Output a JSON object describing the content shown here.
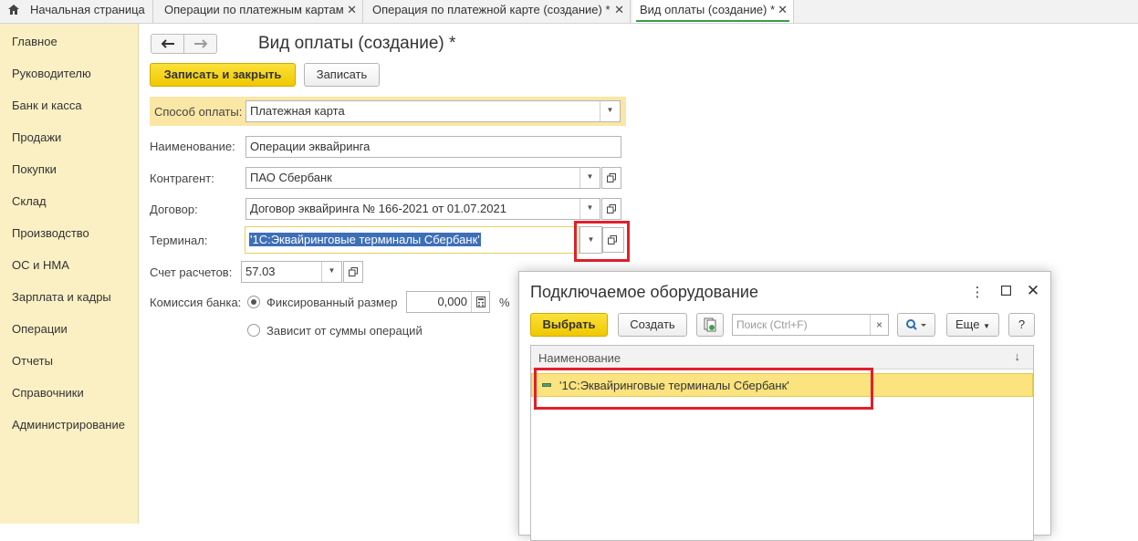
{
  "tabs": [
    {
      "label": "Начальная страница"
    },
    {
      "label": "Операции по платежным картам",
      "close": "✕"
    },
    {
      "label": "Операция по платежной карте (создание) *",
      "close": "✕"
    },
    {
      "label": "Вид оплаты (создание) *",
      "close": "✕"
    }
  ],
  "sidebar": {
    "items": [
      {
        "label": "Главное"
      },
      {
        "label": "Руководителю"
      },
      {
        "label": "Банк и касса"
      },
      {
        "label": "Продажи"
      },
      {
        "label": "Покупки"
      },
      {
        "label": "Склад"
      },
      {
        "label": "Производство"
      },
      {
        "label": "ОС и НМА"
      },
      {
        "label": "Зарплата и кадры"
      },
      {
        "label": "Операции"
      },
      {
        "label": "Отчеты"
      },
      {
        "label": "Справочники"
      },
      {
        "label": "Администрирование"
      }
    ]
  },
  "form": {
    "title": "Вид оплаты (создание) *",
    "save_close_label": "Записать и закрыть",
    "save_label": "Записать",
    "payment_method": {
      "label": "Способ оплаты:",
      "value": "Платежная карта"
    },
    "name": {
      "label": "Наименование:",
      "value": "Операции эквайринга"
    },
    "counterparty": {
      "label": "Контрагент:",
      "value": "ПАО Сбербанк"
    },
    "contract": {
      "label": "Договор:",
      "value": "Договор эквайринга № 166-2021 от 01.07.2021"
    },
    "terminal": {
      "label": "Терминал:",
      "value": "'1С:Эквайринговые терминалы Сбербанк'"
    },
    "account": {
      "label": "Счет расчетов:",
      "value": "57.03"
    },
    "commission": {
      "label": "Комиссия банка:",
      "option_fixed": "Фиксированный размер",
      "amount": "0,000",
      "percent": "%",
      "option_depends": "Зависит от суммы операций"
    }
  },
  "dialog": {
    "title": "Подключаемое оборудование",
    "select_label": "Выбрать",
    "create_label": "Создать",
    "search_placeholder": "Поиск (Ctrl+F)",
    "clear": "×",
    "more_label": "Еще",
    "help_label": "?",
    "column_header": "Наименование",
    "sort_glyph": "↓",
    "rows": [
      {
        "name": "'1С:Эквайринговые терминалы Сбербанк'"
      }
    ]
  },
  "colors": {
    "accent_yellow": "#f0c800",
    "sidebar_bg": "#fbf0c4",
    "annotation_red": "#e0202a",
    "selection_blue": "#3d6fb6",
    "row_highlight": "#fbe37f"
  }
}
